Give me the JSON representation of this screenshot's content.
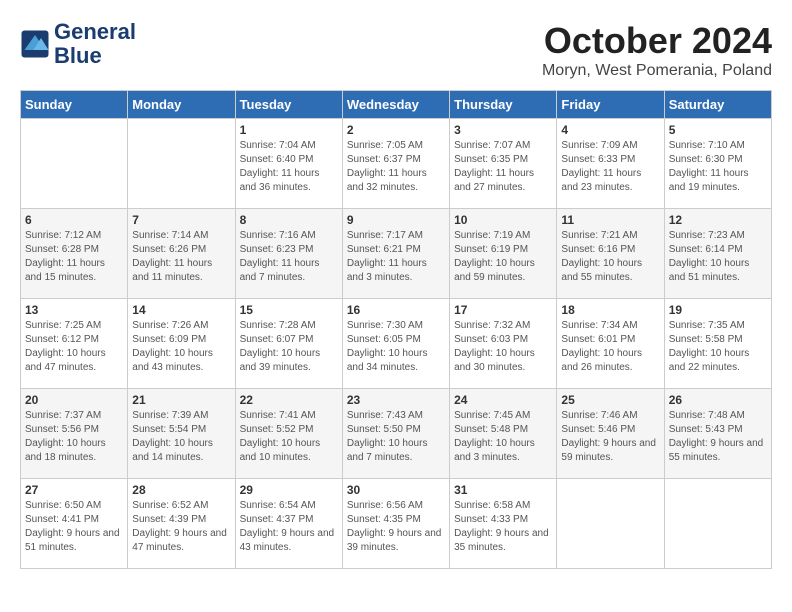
{
  "header": {
    "logo_line1": "General",
    "logo_line2": "Blue",
    "month": "October 2024",
    "location": "Moryn, West Pomerania, Poland"
  },
  "weekdays": [
    "Sunday",
    "Monday",
    "Tuesday",
    "Wednesday",
    "Thursday",
    "Friday",
    "Saturday"
  ],
  "weeks": [
    [
      {
        "day": "",
        "info": ""
      },
      {
        "day": "",
        "info": ""
      },
      {
        "day": "1",
        "info": "Sunrise: 7:04 AM\nSunset: 6:40 PM\nDaylight: 11 hours and 36 minutes."
      },
      {
        "day": "2",
        "info": "Sunrise: 7:05 AM\nSunset: 6:37 PM\nDaylight: 11 hours and 32 minutes."
      },
      {
        "day": "3",
        "info": "Sunrise: 7:07 AM\nSunset: 6:35 PM\nDaylight: 11 hours and 27 minutes."
      },
      {
        "day": "4",
        "info": "Sunrise: 7:09 AM\nSunset: 6:33 PM\nDaylight: 11 hours and 23 minutes."
      },
      {
        "day": "5",
        "info": "Sunrise: 7:10 AM\nSunset: 6:30 PM\nDaylight: 11 hours and 19 minutes."
      }
    ],
    [
      {
        "day": "6",
        "info": "Sunrise: 7:12 AM\nSunset: 6:28 PM\nDaylight: 11 hours and 15 minutes."
      },
      {
        "day": "7",
        "info": "Sunrise: 7:14 AM\nSunset: 6:26 PM\nDaylight: 11 hours and 11 minutes."
      },
      {
        "day": "8",
        "info": "Sunrise: 7:16 AM\nSunset: 6:23 PM\nDaylight: 11 hours and 7 minutes."
      },
      {
        "day": "9",
        "info": "Sunrise: 7:17 AM\nSunset: 6:21 PM\nDaylight: 11 hours and 3 minutes."
      },
      {
        "day": "10",
        "info": "Sunrise: 7:19 AM\nSunset: 6:19 PM\nDaylight: 10 hours and 59 minutes."
      },
      {
        "day": "11",
        "info": "Sunrise: 7:21 AM\nSunset: 6:16 PM\nDaylight: 10 hours and 55 minutes."
      },
      {
        "day": "12",
        "info": "Sunrise: 7:23 AM\nSunset: 6:14 PM\nDaylight: 10 hours and 51 minutes."
      }
    ],
    [
      {
        "day": "13",
        "info": "Sunrise: 7:25 AM\nSunset: 6:12 PM\nDaylight: 10 hours and 47 minutes."
      },
      {
        "day": "14",
        "info": "Sunrise: 7:26 AM\nSunset: 6:09 PM\nDaylight: 10 hours and 43 minutes."
      },
      {
        "day": "15",
        "info": "Sunrise: 7:28 AM\nSunset: 6:07 PM\nDaylight: 10 hours and 39 minutes."
      },
      {
        "day": "16",
        "info": "Sunrise: 7:30 AM\nSunset: 6:05 PM\nDaylight: 10 hours and 34 minutes."
      },
      {
        "day": "17",
        "info": "Sunrise: 7:32 AM\nSunset: 6:03 PM\nDaylight: 10 hours and 30 minutes."
      },
      {
        "day": "18",
        "info": "Sunrise: 7:34 AM\nSunset: 6:01 PM\nDaylight: 10 hours and 26 minutes."
      },
      {
        "day": "19",
        "info": "Sunrise: 7:35 AM\nSunset: 5:58 PM\nDaylight: 10 hours and 22 minutes."
      }
    ],
    [
      {
        "day": "20",
        "info": "Sunrise: 7:37 AM\nSunset: 5:56 PM\nDaylight: 10 hours and 18 minutes."
      },
      {
        "day": "21",
        "info": "Sunrise: 7:39 AM\nSunset: 5:54 PM\nDaylight: 10 hours and 14 minutes."
      },
      {
        "day": "22",
        "info": "Sunrise: 7:41 AM\nSunset: 5:52 PM\nDaylight: 10 hours and 10 minutes."
      },
      {
        "day": "23",
        "info": "Sunrise: 7:43 AM\nSunset: 5:50 PM\nDaylight: 10 hours and 7 minutes."
      },
      {
        "day": "24",
        "info": "Sunrise: 7:45 AM\nSunset: 5:48 PM\nDaylight: 10 hours and 3 minutes."
      },
      {
        "day": "25",
        "info": "Sunrise: 7:46 AM\nSunset: 5:46 PM\nDaylight: 9 hours and 59 minutes."
      },
      {
        "day": "26",
        "info": "Sunrise: 7:48 AM\nSunset: 5:43 PM\nDaylight: 9 hours and 55 minutes."
      }
    ],
    [
      {
        "day": "27",
        "info": "Sunrise: 6:50 AM\nSunset: 4:41 PM\nDaylight: 9 hours and 51 minutes."
      },
      {
        "day": "28",
        "info": "Sunrise: 6:52 AM\nSunset: 4:39 PM\nDaylight: 9 hours and 47 minutes."
      },
      {
        "day": "29",
        "info": "Sunrise: 6:54 AM\nSunset: 4:37 PM\nDaylight: 9 hours and 43 minutes."
      },
      {
        "day": "30",
        "info": "Sunrise: 6:56 AM\nSunset: 4:35 PM\nDaylight: 9 hours and 39 minutes."
      },
      {
        "day": "31",
        "info": "Sunrise: 6:58 AM\nSunset: 4:33 PM\nDaylight: 9 hours and 35 minutes."
      },
      {
        "day": "",
        "info": ""
      },
      {
        "day": "",
        "info": ""
      }
    ]
  ]
}
